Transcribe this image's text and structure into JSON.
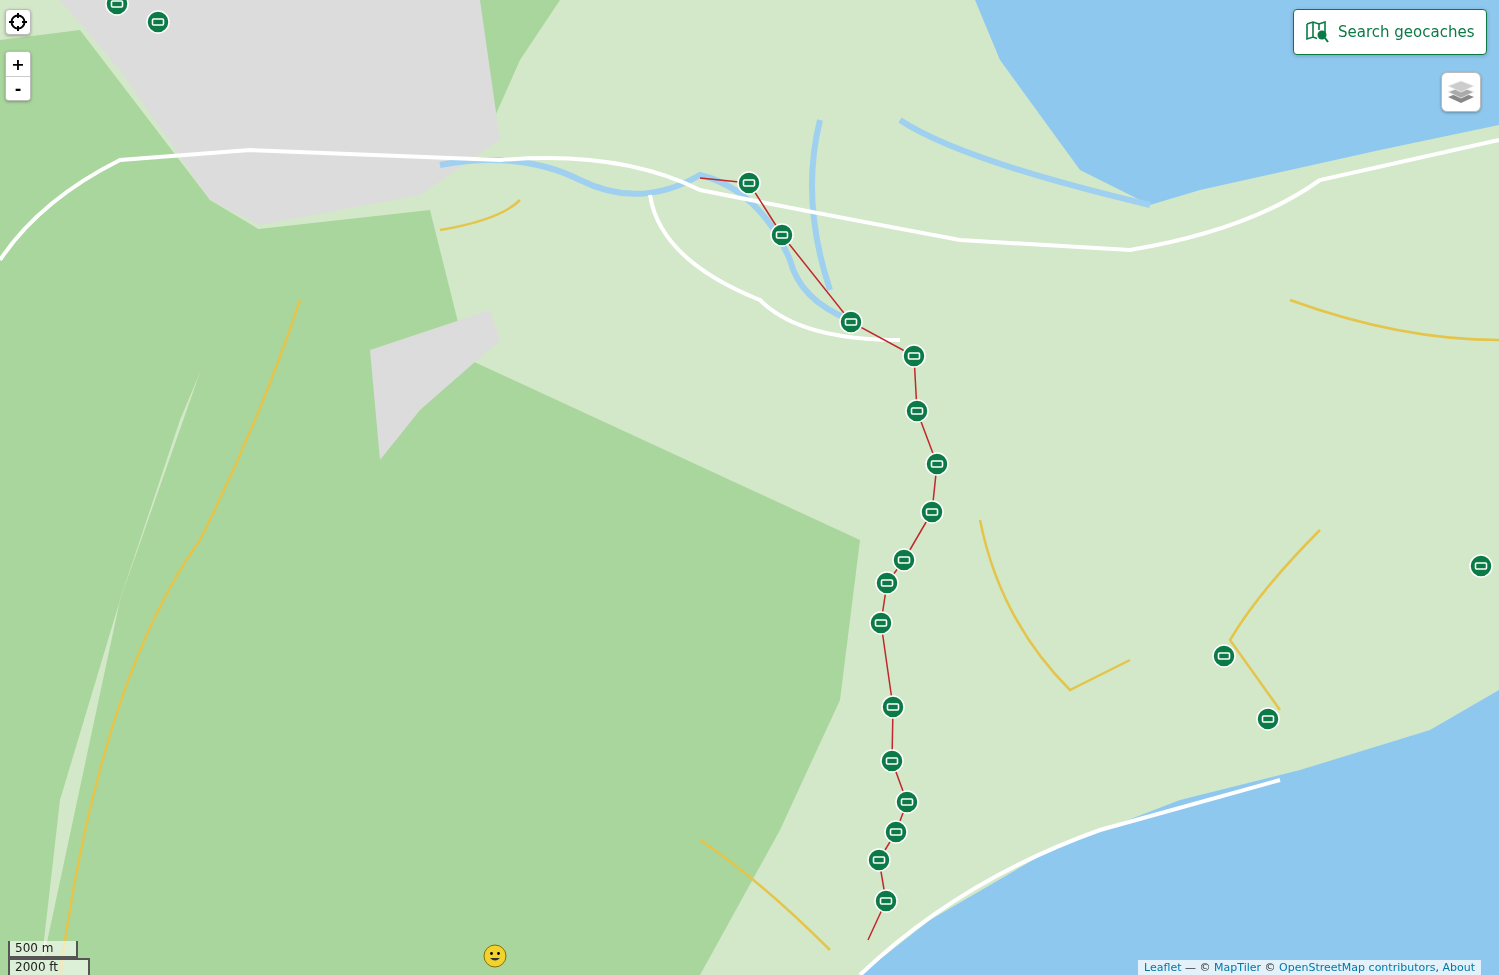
{
  "zoom_controls": {
    "zoom_in": "+",
    "zoom_out": "-"
  },
  "search_button": {
    "label": "Search geocaches"
  },
  "scale": {
    "metric": "500 m",
    "imperial": "2000 ft"
  },
  "attribution": [
    {
      "kind": "link",
      "text": "Leaflet"
    },
    {
      "kind": "text",
      "text": " — © "
    },
    {
      "kind": "link",
      "text": "MapTiler"
    },
    {
      "kind": "text",
      "text": " © "
    },
    {
      "kind": "link",
      "text": "OpenStreetMap contributors"
    },
    {
      "kind": "text",
      "text": ", "
    },
    {
      "kind": "link",
      "text": "About"
    }
  ]
}
